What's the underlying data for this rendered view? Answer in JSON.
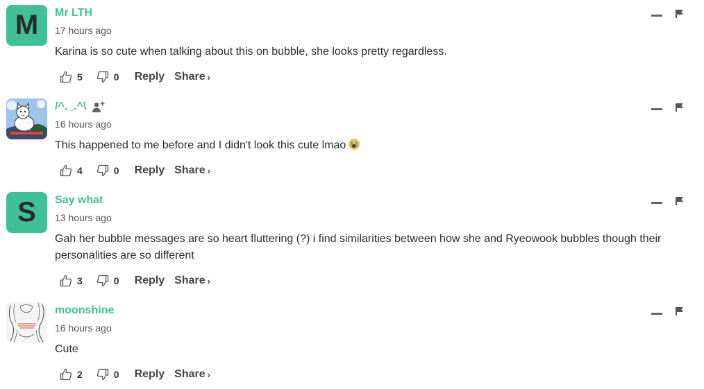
{
  "comments": [
    {
      "author": "Mr LTH",
      "avatar_letter": "M",
      "time": "17 hours ago",
      "text": "Karina is so cute when talking about this on bubble, she looks pretty regardless.",
      "likes": "5",
      "dislikes": "0"
    },
    {
      "author": "/^._.^\\",
      "avatar_icon": "cat-illustration-avatar",
      "time": "16 hours ago",
      "text": "This happened to me before and I didn't look this cute lmao",
      "emoji": "crying-face-emoji",
      "likes": "4",
      "dislikes": "0"
    },
    {
      "author": "Say what",
      "avatar_letter": "S",
      "time": "13 hours ago",
      "text": "Gah her bubble messages are so heart fluttering (?) i find similarities between how she and Ryeowook bubbles though their personalities are so different",
      "likes": "3",
      "dislikes": "0"
    },
    {
      "author": "moonshine",
      "avatar_icon": "sketch-image-avatar",
      "time": "16 hours ago",
      "text": "Cute",
      "likes": "2",
      "dislikes": "0"
    }
  ],
  "actions": {
    "reply": "Reply",
    "share": "Share",
    "share_chevron": "›"
  },
  "colors": {
    "accent": "#3fc096",
    "text": "#2b2b2b",
    "muted": "#555555"
  },
  "icons": [
    "thumbs-up-icon",
    "thumbs-down-icon",
    "minimize-icon",
    "flag-icon",
    "follow-user-icon"
  ]
}
